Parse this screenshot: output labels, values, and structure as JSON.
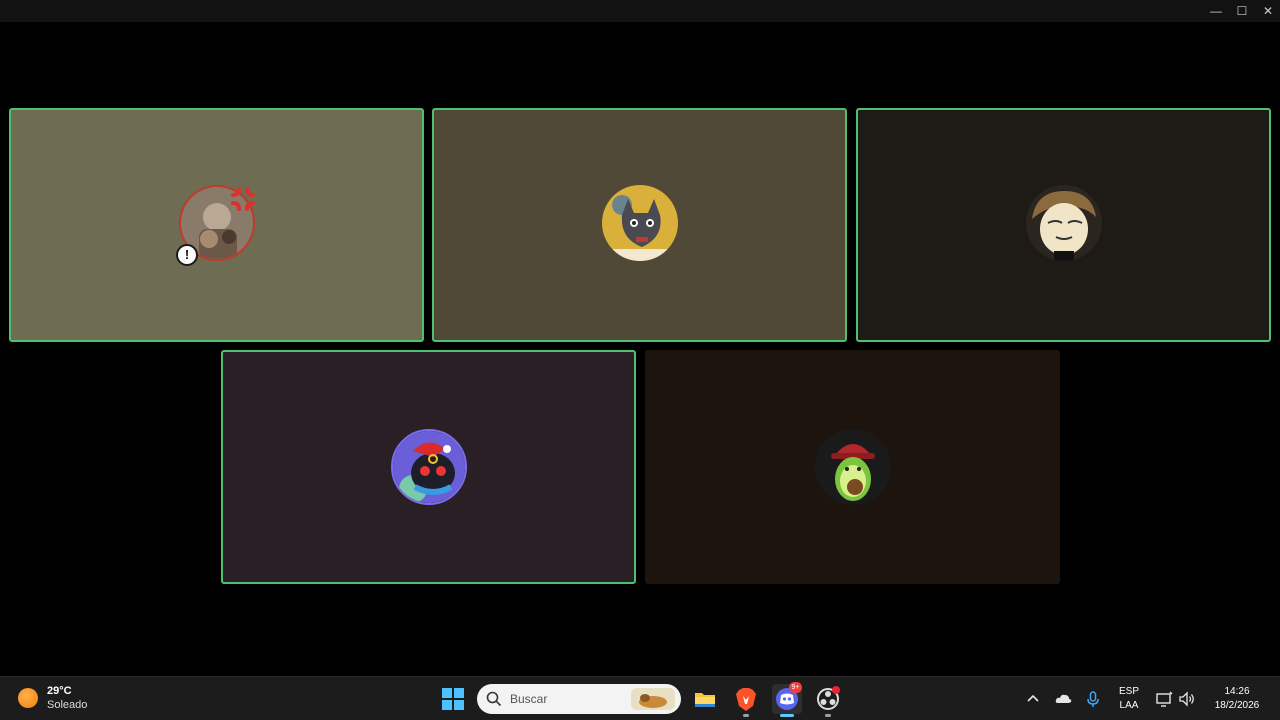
{
  "window": {
    "minimize_glyph": "—",
    "maximize_glyph": "☐",
    "close_glyph": "✕"
  },
  "call": {
    "participants": [
      {
        "id": "p1",
        "speaking": true,
        "status_badge": "!",
        "bg": "#6e6c52"
      },
      {
        "id": "p2",
        "speaking": true,
        "status_badge": "",
        "bg": "#514937"
      },
      {
        "id": "p3",
        "speaking": true,
        "status_badge": "",
        "bg": "#1e1b16"
      },
      {
        "id": "p4",
        "speaking": true,
        "status_badge": "",
        "bg": "#2a1f24"
      },
      {
        "id": "p5",
        "speaking": false,
        "status_badge": "",
        "bg": "#1e140e"
      }
    ],
    "speaking_border_color": "#4fbf71"
  },
  "taskbar": {
    "weather": {
      "temp": "29°C",
      "desc": "Soleado"
    },
    "search": {
      "placeholder": "Buscar"
    },
    "pinned": [
      "windows-start-icon",
      "file-explorer-icon",
      "brave-browser-icon",
      "discord-icon",
      "obs-icon"
    ],
    "discord_badge": "9+",
    "tray": {
      "language": "ESP",
      "layout": "LAA",
      "time": "14:26",
      "date": "18/2/2026"
    }
  }
}
